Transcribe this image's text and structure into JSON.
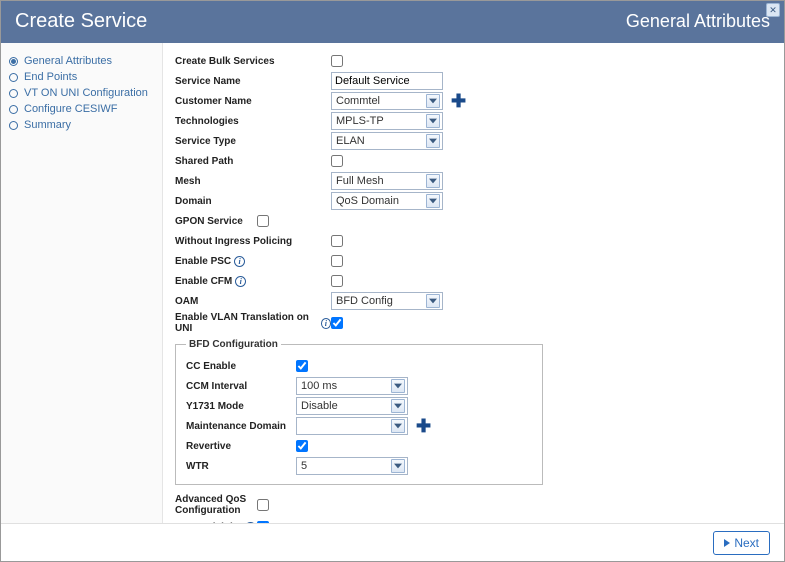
{
  "header": {
    "title": "Create Service",
    "section": "General Attributes"
  },
  "sidebar": {
    "items": [
      {
        "label": "General Attributes",
        "active": true
      },
      {
        "label": "End Points",
        "active": false
      },
      {
        "label": "VT ON UNI Configuration",
        "active": false
      },
      {
        "label": "Configure CESIWF",
        "active": false
      },
      {
        "label": "Summary",
        "active": false
      }
    ]
  },
  "form": {
    "create_bulk_label": "Create Bulk Services",
    "create_bulk_checked": false,
    "service_name_label": "Service Name",
    "service_name_value": "Default Service",
    "customer_name_label": "Customer Name",
    "customer_name_value": "Commtel",
    "technologies_label": "Technologies",
    "technologies_value": "MPLS-TP",
    "service_type_label": "Service Type",
    "service_type_value": "ELAN",
    "shared_path_label": "Shared Path",
    "shared_path_checked": false,
    "mesh_label": "Mesh",
    "mesh_value": "Full Mesh",
    "domain_label": "Domain",
    "domain_value": "QoS Domain",
    "gpon_label": "GPON Service",
    "gpon_checked": false,
    "without_ingress_label": "Without Ingress Policing",
    "without_ingress_checked": false,
    "enable_psc_label": "Enable PSC",
    "enable_psc_checked": false,
    "enable_cfm_label": "Enable CFM",
    "enable_cfm_checked": false,
    "oam_label": "OAM",
    "oam_value": "BFD Config",
    "enable_vlan_label": "Enable VLAN Translation on UNI",
    "enable_vlan_checked": true,
    "advanced_qos_label": "Advanced QoS Configuration",
    "advanced_qos_checked": false,
    "srlg_label": "SRLG Disjoint",
    "srlg_checked": true
  },
  "bfd": {
    "legend": "BFD Configuration",
    "cc_enable_label": "CC Enable",
    "cc_enable_checked": true,
    "ccm_interval_label": "CCM Interval",
    "ccm_interval_value": "100 ms",
    "y1731_label": "Y1731 Mode",
    "y1731_value": "Disable",
    "maint_domain_label": "Maintenance Domain",
    "maint_domain_value": "",
    "revertive_label": "Revertive",
    "revertive_checked": true,
    "wtr_label": "WTR",
    "wtr_value": "5"
  },
  "footer": {
    "next_label": "Next"
  }
}
